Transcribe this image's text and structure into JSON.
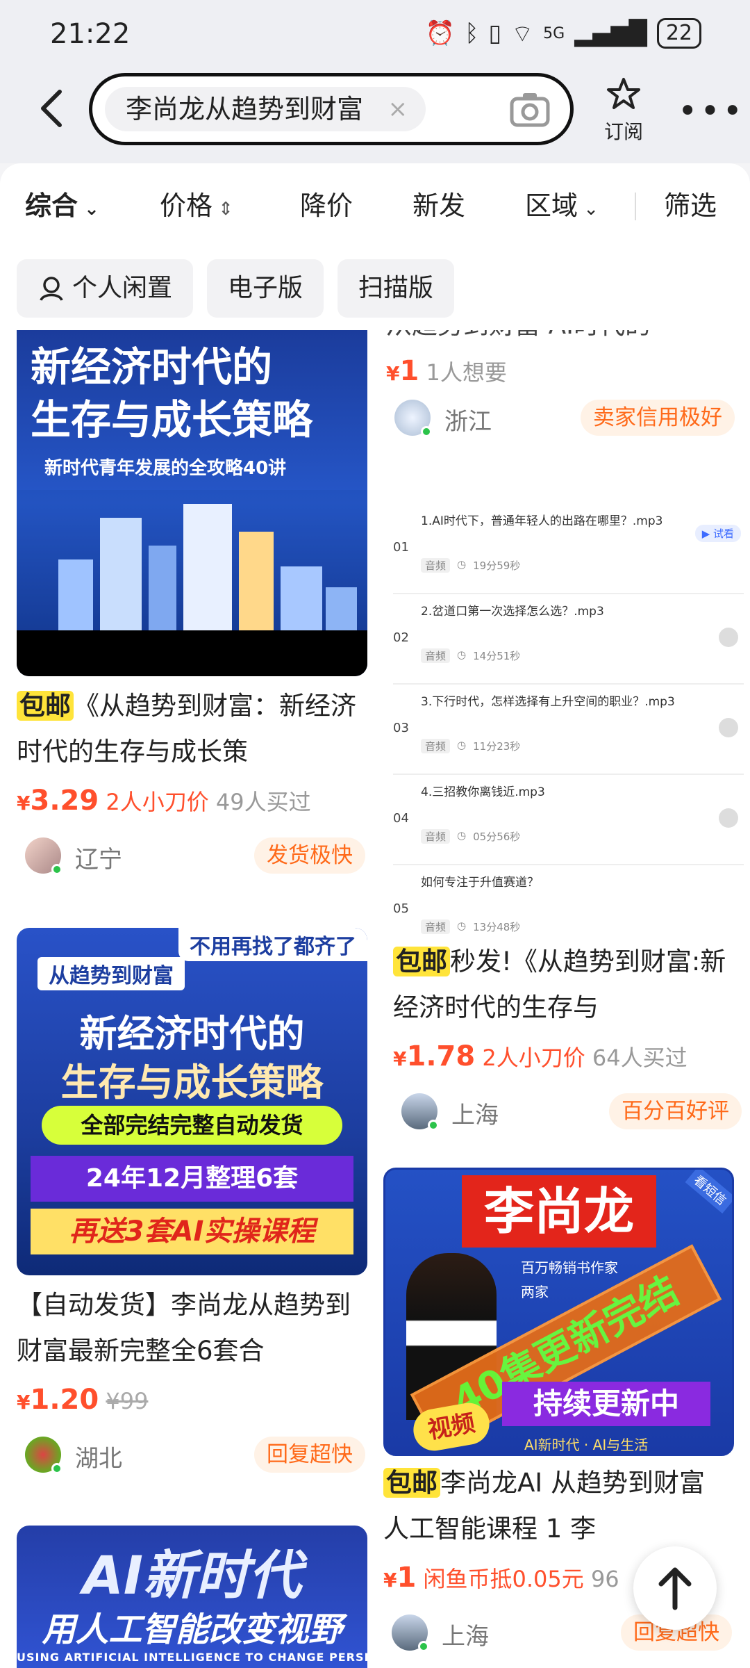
{
  "status_bar": {
    "time": "21:22",
    "battery": "22",
    "network": "5G"
  },
  "search": {
    "query": "李尚龙从趋势到财富",
    "clear_icon": "×",
    "subscribe_label": "订阅"
  },
  "filters": {
    "items": [
      {
        "label": "综合",
        "icon": "chevron-down"
      },
      {
        "label": "价格",
        "icon": "sort-arrows"
      },
      {
        "label": "降价"
      },
      {
        "label": "新发"
      },
      {
        "label": "区域",
        "icon": "chevron-down"
      },
      {
        "label": "筛选"
      }
    ]
  },
  "tags": [
    "个人闲置",
    "电子版",
    "扫描版"
  ],
  "cards": {
    "c1": {
      "image": {
        "line1": "新经济时代的",
        "line2": "生存与成长策略",
        "line3": "新时代青年发展的全攻略40讲"
      },
      "baoyou": "包邮",
      "title": "《从趋势到财富：新经济时代的生存与成长策",
      "currency": "¥",
      "price": "3.29",
      "bargain": "2人小刀价",
      "sold": "49人买过",
      "location": "辽宁",
      "badge": "发货极快"
    },
    "c2": {
      "title_partial": "从趋势到财富  AI时代的",
      "currency": "¥",
      "price": "1",
      "wants": "1人想要",
      "location": "浙江",
      "badge": "卖家信用极好"
    },
    "c3": {
      "playlist": [
        {
          "no": "01",
          "title": "1.AI时代下，普通年轻人的出路在哪里？.mp3",
          "type": "音频",
          "duration": "19分59秒",
          "action": "▶ 试看"
        },
        {
          "no": "02",
          "title": "2.岔道口第一次选择怎么选？.mp3",
          "type": "音频",
          "duration": "14分51秒"
        },
        {
          "no": "03",
          "title": "3.下行时代，怎样选择有上升空间的职业？.mp3",
          "type": "音频",
          "duration": "11分23秒"
        },
        {
          "no": "04",
          "title": "4.三招教你离钱近.mp3",
          "type": "音频",
          "duration": "05分56秒"
        },
        {
          "no": "05",
          "title": "如何专注于升值赛道？",
          "type": "音频",
          "duration": "13分48秒"
        }
      ],
      "baoyou": "包邮",
      "title": "秒发!《从趋势到财富:新经济时代的生存与",
      "currency": "¥",
      "price": "1.78",
      "bargain": "2人小刀价",
      "sold": "64人买过",
      "location": "上海",
      "badge": "百分百好评"
    },
    "c4": {
      "image": {
        "ribbon": "不用再找了都齐了",
        "label": "从趋势到财富",
        "line1": "新经济时代的",
        "line2": "生存与成长策略",
        "pill": "全部完结完整自动发货",
        "band": "24年12月整理6套",
        "bottom": "再送3套AI实操课程"
      },
      "title": "【自动发货】李尚龙从趋势到财富最新完整全6套合",
      "currency": "¥",
      "price": "1.20",
      "original_price": "¥99",
      "location": "湖北",
      "badge": "回复超快"
    },
    "c5": {
      "image": {
        "name": "李尚龙",
        "corner": "看短信",
        "sub1": "百万畅销书作家",
        "sub2": "两家",
        "diag": "40集更新完结",
        "ongoing": "持续更新中",
        "video": "视频",
        "footer": "AI新时代 · AI与生活"
      },
      "baoyou": "包邮",
      "title": "李尚龙AI  从趋势到财富  人工智能课程 1 李",
      "currency": "¥",
      "price": "1",
      "coin": "闲鱼币抵0.05元",
      "sold": "96",
      "location": "上海",
      "badge": "回复超快"
    },
    "c6": {
      "image": {
        "line1": "AI新时代",
        "line2": "用人工智能改变视野",
        "line3": "USING ARTIFICIAL INTELLIGENCE TO CHANGE PERSPECTIVES"
      }
    }
  },
  "colors": {
    "accent_price": "#ff4f2c",
    "badge_text": "#ff6a1a",
    "baoyou_bg": "#ffe43a"
  }
}
